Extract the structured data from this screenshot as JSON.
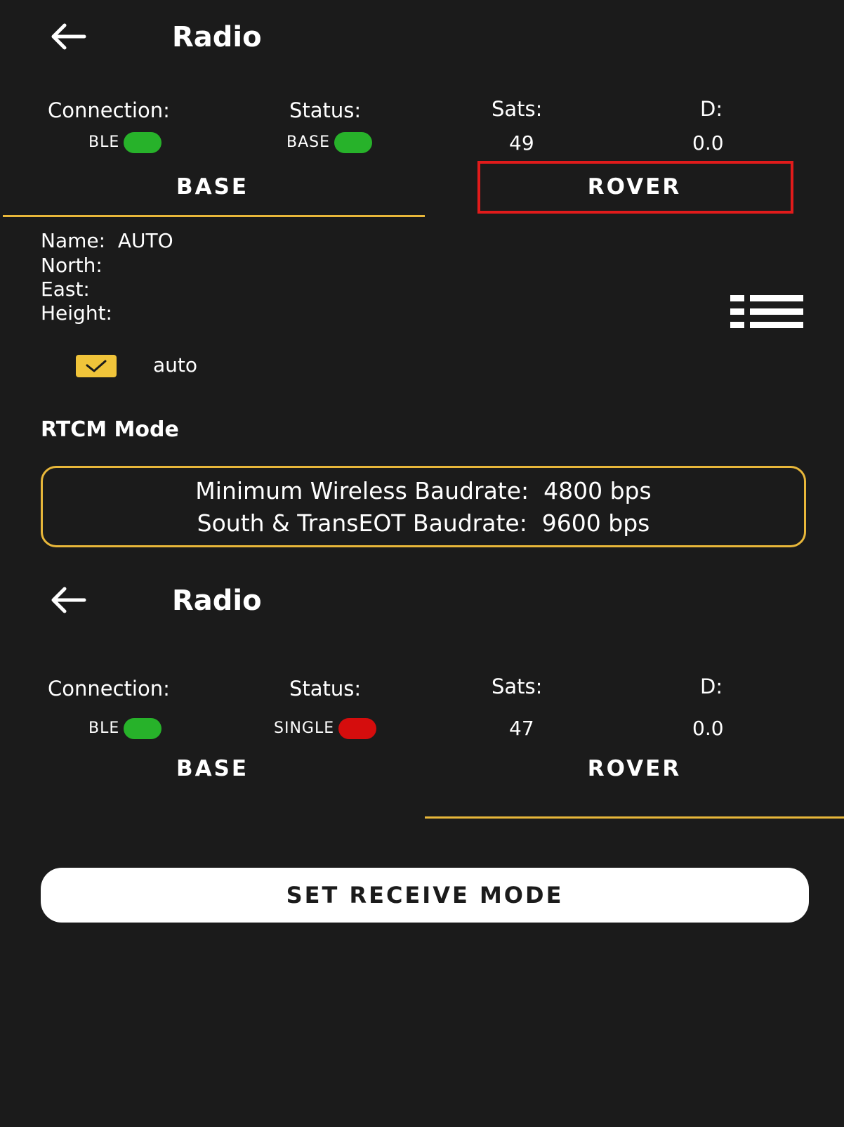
{
  "screens": [
    {
      "header": {
        "title": "Radio"
      },
      "status": {
        "connection_label": "Connection:",
        "connection_value": "BLE",
        "connection_color": "#27b22a",
        "status_label": "Status:",
        "status_value": "BASE",
        "status_color": "#27b22a",
        "sats_label": "Sats:",
        "sats_value": "49",
        "d_label": "D:",
        "d_value": "0.0"
      },
      "tabs": {
        "base": "BASE",
        "rover": "ROVER",
        "active": "BASE"
      }
    },
    {
      "header": {
        "title": "Radio"
      },
      "status": {
        "connection_label": "Connection:",
        "connection_value": "BLE",
        "connection_color": "#27b22a",
        "status_label": "Status:",
        "status_value": "SINGLE",
        "status_color": "#d50d0d",
        "sats_label": "Sats:",
        "sats_value": "47",
        "d_label": "D:",
        "d_value": "0.0"
      },
      "tabs": {
        "base": "BASE",
        "rover": "ROVER",
        "active": "ROVER"
      }
    }
  ],
  "base_panel": {
    "name_label": "Name:",
    "name_value": "AUTO",
    "north_label": "North:",
    "east_label": "East:",
    "height_label": "Height:",
    "auto_checkbox": {
      "label": "auto",
      "checked": true
    },
    "list_icon": "list-icon"
  },
  "rtcm": {
    "heading": "RTCM Mode",
    "line1": "Minimum Wireless Baudrate:  4800 bps",
    "line2": "South & TransEOT Baudrate:  9600 bps"
  },
  "rover_panel": {
    "set_receive_button": "SET RECEIVE MODE"
  },
  "colors": {
    "accent": "#e8b73a",
    "highlight": "#e11b1b",
    "background": "#1b1b1b"
  }
}
